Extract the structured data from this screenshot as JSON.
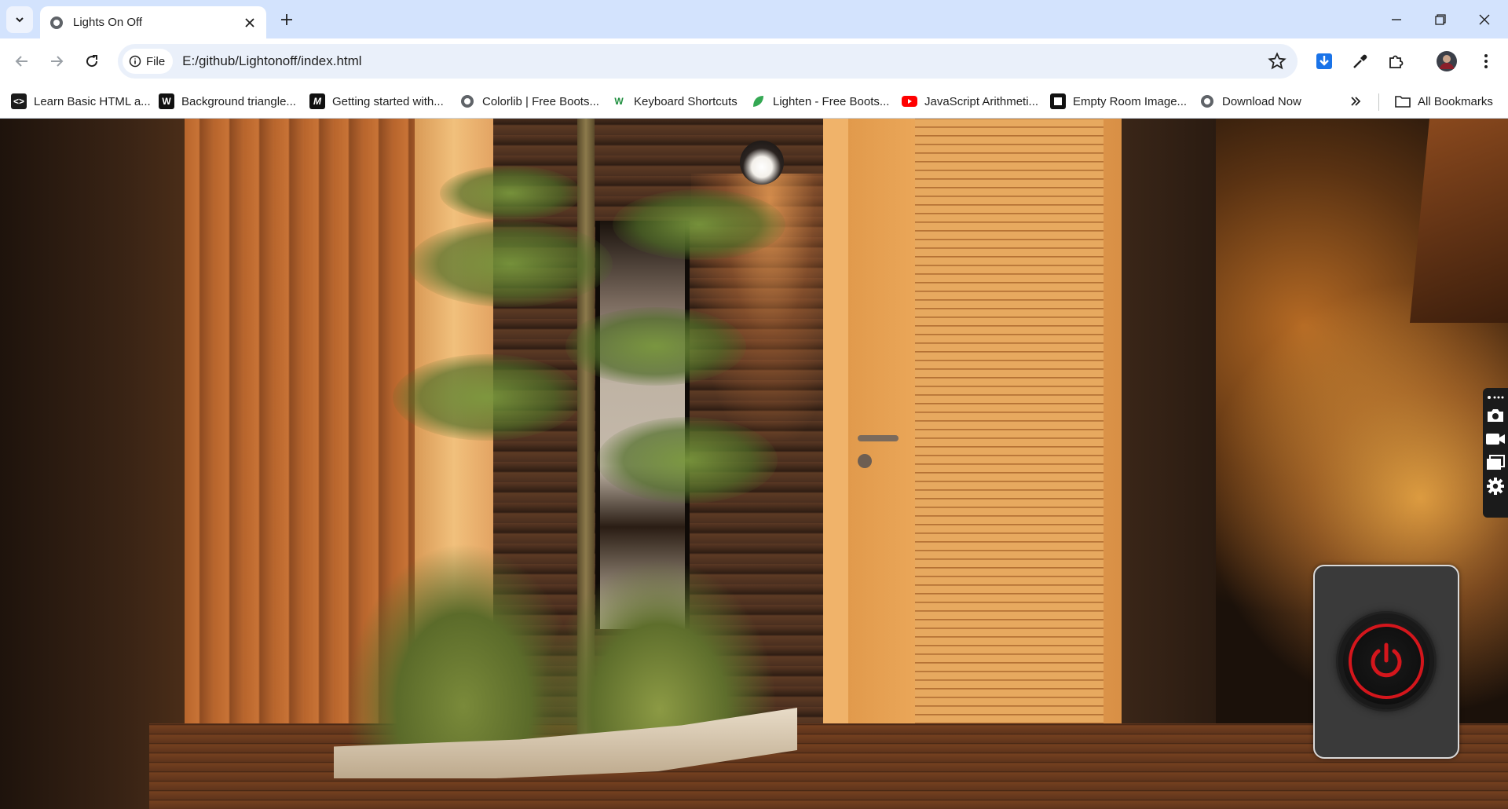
{
  "browser": {
    "tab": {
      "title": "Lights On Off"
    },
    "address": {
      "scheme_chip": "File",
      "url": "E:/github/Lightonoff/index.html"
    },
    "bookmarks": [
      {
        "label": "Learn Basic HTML a...",
        "icon": "code-icon"
      },
      {
        "label": "Background triangle...",
        "icon": "w-icon"
      },
      {
        "label": "Getting started with...",
        "icon": "m-icon"
      },
      {
        "label": "Colorlib | Free Boots...",
        "icon": "globe-icon"
      },
      {
        "label": "Keyboard Shortcuts",
        "icon": "w-green-icon"
      },
      {
        "label": "Lighten - Free Boots...",
        "icon": "leaf-icon"
      },
      {
        "label": "JavaScript Arithmeti...",
        "icon": "youtube-icon"
      },
      {
        "label": "Empty Room Image...",
        "icon": "square-icon"
      },
      {
        "label": "Download Now",
        "icon": "globe-icon"
      }
    ],
    "all_bookmarks_label": "All Bookmarks"
  },
  "page": {
    "power_button": {
      "state": "off",
      "accent_color": "#d4161c"
    }
  },
  "colors": {
    "tabstrip": "#d3e3fd",
    "omnibox": "#eaf0fa",
    "panel": "#3a3a3a"
  }
}
